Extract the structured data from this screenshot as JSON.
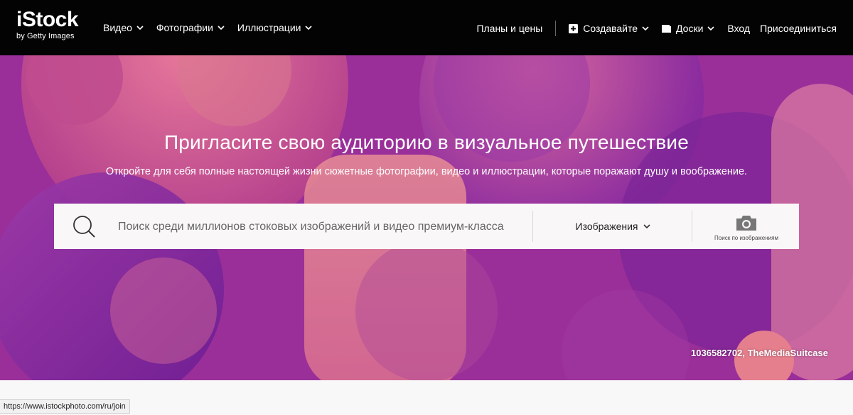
{
  "brand": {
    "name": "iStock",
    "tagline": "by Getty Images"
  },
  "nav": {
    "left": [
      {
        "label": "Видео"
      },
      {
        "label": "Фотографии"
      },
      {
        "label": "Иллюстрации"
      }
    ],
    "plans_label": "Планы и цены",
    "create_label": "Создавайте",
    "boards_label": "Доски",
    "login_label": "Вход",
    "join_label": "Присоединиться"
  },
  "hero": {
    "title": "Пригласите свою аудиторию в визуальное путешествие",
    "subtitle": "Откройте для себя полные настоящей жизни сюжетные фотографии, видео и иллюстрации, которые поражают душу и воображение.",
    "credit": "1036582702, TheMediaSuitcase"
  },
  "search": {
    "placeholder": "Поиск среди миллионов стоковых изображений и видео премиум-класса",
    "value": "",
    "media_type": "Изображения",
    "visual_search_label": "Поиск по изображениям"
  },
  "status_bar": {
    "url": "https://www.istockphoto.com/ru/join"
  },
  "icons": {
    "search": "search-icon",
    "camera": "camera-icon",
    "create": "plus-square-icon",
    "boards": "boards-icon",
    "chevron": "chevron-down-icon"
  },
  "colors": {
    "topbar": "#030303",
    "hero_purple": "#8d2ca0",
    "hero_pink": "#c24e8d",
    "search_bg": "#faf7f9"
  }
}
